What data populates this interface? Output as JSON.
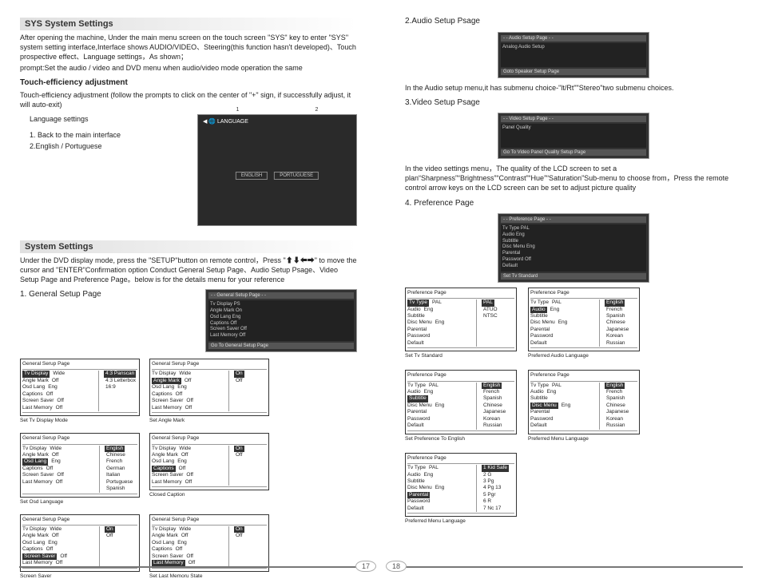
{
  "left": {
    "sys_title": "SYS System Settings",
    "sys_p1": "After opening the machine, Under the main menu screen on the touch screen \"SYS\" key to enter \"SYS\" system setting interface,Interface shows AUDIO/VIDEO、Steering(this function hasn't developed)、Touch prospective effect、Language settings，As shown；",
    "sys_p2": "prompt:Set the audio / video and DVD menu when audio/video mode operation the same",
    "touch_title": "Touch-efficiency adjustment",
    "touch_p": "Touch-efficiency adjustment (follow the prompts to click on the center of \"+\" sign, if successfully adjust, it will auto-exit)",
    "lang_settings": "Language settings",
    "lang_1": "1. Back to the main interface",
    "lang_2": "2.English / Portuguese",
    "lang_marker_1": "1",
    "lang_marker_2": "2",
    "lang_btn1": "ENGLISH",
    "lang_btn2": "PORTUGUESE",
    "lang_top": "◀ 🌐 LANGUAGE",
    "settings_title": "System Settings",
    "settings_p1": "Under the DVD display mode, press the \"SETUP\"button on remote control，Press \"⬆⬇⬅➡\" to move the cursor and \"ENTER\"Confirmation option Conduct General Setup Page、Audio Setup Psage、Video Setup Page and Preference  Page。below is for the details menu for your reference",
    "gen_title": "1. General Setup Page",
    "gen_thumb_title": "- - General  Setup  Page  - -",
    "gen_thumb_footer": "Go  To  General  Setup  Page",
    "gen_list": [
      "Tv Display      PS",
      "Angle Mark     On",
      "Osd Lang        Eng",
      "Captions         Off",
      "Screen Saver  Off",
      "Last Memory   Off"
    ],
    "gtables": [
      {
        "caption": "General  Serup  Page",
        "rows": [
          [
            "Tv Display",
            "Wide",
            "hl"
          ],
          [
            "Angle Mark",
            "Off",
            ""
          ],
          [
            "Osd Lang",
            "Eng",
            ""
          ],
          [
            "Captions",
            "Off",
            ""
          ],
          [
            "Screen Saver",
            "Off",
            ""
          ],
          [
            "Last Memory",
            "Off",
            ""
          ]
        ],
        "right": [
          "4:3  Panscan",
          "4:3  Letterbox",
          "16:9"
        ],
        "foot": "Set Tv  Display Mode"
      },
      {
        "caption": "General  Serup  Page",
        "rows": [
          [
            "Tv Display",
            "Wide",
            ""
          ],
          [
            "Angle Mark",
            "Off",
            "hl"
          ],
          [
            "Osd Lang",
            "Eng",
            ""
          ],
          [
            "Captions",
            "Off",
            ""
          ],
          [
            "Screen Saver",
            "Off",
            ""
          ],
          [
            "Last Memory",
            "Off",
            ""
          ]
        ],
        "right": [
          "On",
          "Off"
        ],
        "foot": "Set  Angle  Mark"
      },
      {
        "caption": "General  Serup  Page",
        "rows": [
          [
            "Tv Display",
            "Wide",
            ""
          ],
          [
            "Angle Mark",
            "Off",
            ""
          ],
          [
            "Osd Lang",
            "Eng",
            "hl"
          ],
          [
            "Captions",
            "Off",
            ""
          ],
          [
            "Screen Saver",
            "Off",
            ""
          ],
          [
            "Last Memory",
            "Off",
            ""
          ]
        ],
        "right": [
          "English",
          "Chinese",
          "French",
          "German",
          "Italian",
          "Portuguese",
          "Spanish"
        ],
        "foot": "Set  Osd  Language"
      },
      {
        "caption": "General  Serup  Page",
        "rows": [
          [
            "Tv Display",
            "Wide",
            ""
          ],
          [
            "Angle Mark",
            "Off",
            ""
          ],
          [
            "Osd Lang",
            "Eng",
            ""
          ],
          [
            "Captions",
            "Off",
            "hl"
          ],
          [
            "Screen Saver",
            "Off",
            ""
          ],
          [
            "Last Memory",
            "Off",
            ""
          ]
        ],
        "right": [
          "On",
          "Off"
        ],
        "foot": "Closed  Caption"
      },
      {
        "caption": "General  Serup  Page",
        "rows": [
          [
            "Tv Display",
            "Wide",
            ""
          ],
          [
            "Angle Mark",
            "Off",
            ""
          ],
          [
            "Osd Lang",
            "Eng",
            ""
          ],
          [
            "Captions",
            "Off",
            ""
          ],
          [
            "Screen Saver",
            "Off",
            "hl"
          ],
          [
            "Last Memory",
            "Off",
            ""
          ]
        ],
        "right": [
          "On",
          "Off"
        ],
        "foot": "Screen  Saver"
      },
      {
        "caption": "General  Serup  Page",
        "rows": [
          [
            "Tv Display",
            "Wide",
            ""
          ],
          [
            "Angle Mark",
            "Off",
            ""
          ],
          [
            "Osd Lang",
            "Eng",
            ""
          ],
          [
            "Captions",
            "Off",
            ""
          ],
          [
            "Screen Saver",
            "Off",
            ""
          ],
          [
            "Last Memory",
            "Off",
            "hl"
          ]
        ],
        "right": [
          "On",
          "Off"
        ],
        "foot": "Set  Last  Memoru  State"
      }
    ],
    "page_num": "17"
  },
  "right": {
    "audio_title": "2.Audio Setup Psage",
    "audio_thumb_title": "- - Audio Setup Page  - -",
    "audio_thumb_row": "Analog  Audio  Setup",
    "audio_thumb_footer": "Goto  Speaker  Setup  Page",
    "audio_p": "In the Audio setup menu,it has submenu choice-\"lt/Rt\"\"Stereo\"two submenu  choices.",
    "video_title": "3.Video Setup Psage",
    "video_thumb_title": "- - Video Setup Page - -",
    "video_thumb_row": "Panel  Quality",
    "video_thumb_footer": "Go  To  Video  Panel  Quality  Setup  Page",
    "video_p": "In the video settings menu，The quality of the LCD screen to set a plan“Sharpness”“Brightness”“Contrast”“Hue”“Saturation”Sub-menu to choose from，Press the remote control arrow keys on the LCD screen can be set to adjust picture quality",
    "pref_title": "4. Preference  Page",
    "pref_thumb_title": "- - Preference  Page  - -",
    "pref_thumb_footer": "Set   Tv    Standard",
    "pref_thumb_list": [
      "Tv Type        PAL",
      "Audio            Eng",
      "Subtitle",
      "Disc   Menu   Eng",
      "Parental",
      "Password      Off",
      "Default"
    ],
    "ptables": [
      {
        "caption": "Preference  Page",
        "rows": [
          [
            "Tv Type",
            "PAL",
            "hl"
          ],
          [
            "Audio",
            "Eng",
            ""
          ],
          [
            "Subtitle",
            "",
            ""
          ],
          [
            "Disc  Menu",
            "Eng",
            ""
          ],
          [
            "Parental",
            "",
            ""
          ],
          [
            "Password",
            "",
            ""
          ],
          [
            "Default",
            "",
            ""
          ]
        ],
        "right": [
          "PAL",
          "ATUO",
          "NTSC"
        ],
        "foot": "Set   Tv    Standard"
      },
      {
        "caption": "Preference  Page",
        "rows": [
          [
            "Tv Type",
            "PAL",
            ""
          ],
          [
            "Audio",
            "Eng",
            "hl"
          ],
          [
            "Subtitle",
            "",
            ""
          ],
          [
            "Disc  Menu",
            "Eng",
            ""
          ],
          [
            "Parental",
            "",
            ""
          ],
          [
            "Password",
            "",
            ""
          ],
          [
            "Default",
            "",
            ""
          ]
        ],
        "right": [
          "English",
          "French",
          "Spanish",
          "Chinese",
          "Japanese",
          "Korean",
          "Russian"
        ],
        "foot": "Preferred   Audio    Language"
      },
      {
        "caption": "Preference  Page",
        "rows": [
          [
            "Tv Type",
            "PAL",
            ""
          ],
          [
            "Audio",
            "Eng",
            ""
          ],
          [
            "Subtitle",
            "",
            "hl"
          ],
          [
            "Disc  Menu",
            "Eng",
            ""
          ],
          [
            "Parental",
            "",
            ""
          ],
          [
            "Password",
            "",
            ""
          ],
          [
            "Default",
            "",
            ""
          ]
        ],
        "right": [
          "English",
          "French",
          "Spanish",
          "Chinese",
          "Japanese",
          "Korean",
          "Russian"
        ],
        "foot": "Set   Preference   To   English"
      },
      {
        "caption": "Preference  Page",
        "rows": [
          [
            "Tv Type",
            "PAL",
            ""
          ],
          [
            "Audio",
            "Eng",
            ""
          ],
          [
            "Subtitle",
            "",
            ""
          ],
          [
            "Disc  Menu",
            "Eng",
            "hl"
          ],
          [
            "Parental",
            "",
            ""
          ],
          [
            "Password",
            "",
            ""
          ],
          [
            "Default",
            "",
            ""
          ]
        ],
        "right": [
          "English",
          "French",
          "Spanish",
          "Chinese",
          "Japanese",
          "Korean",
          "Russian"
        ],
        "foot": "Preferred   Menu    Language"
      },
      {
        "caption": "Preference  Page",
        "rows": [
          [
            "Tv Type",
            "PAL",
            ""
          ],
          [
            "Audio",
            "Eng",
            ""
          ],
          [
            "Subtitle",
            "",
            ""
          ],
          [
            "Disc  Menu",
            "Eng",
            ""
          ],
          [
            "Parental",
            "",
            "hl"
          ],
          [
            "Password",
            "",
            ""
          ],
          [
            "Default",
            "",
            ""
          ]
        ],
        "right": [
          "1  Kid  Safe",
          "2  G",
          "3  Pg",
          "4  Pg  13",
          "5  Pgr",
          "6  R",
          "7  Nc  17"
        ],
        "foot": "Preferred   Menu    Language"
      }
    ],
    "page_num": "18"
  }
}
